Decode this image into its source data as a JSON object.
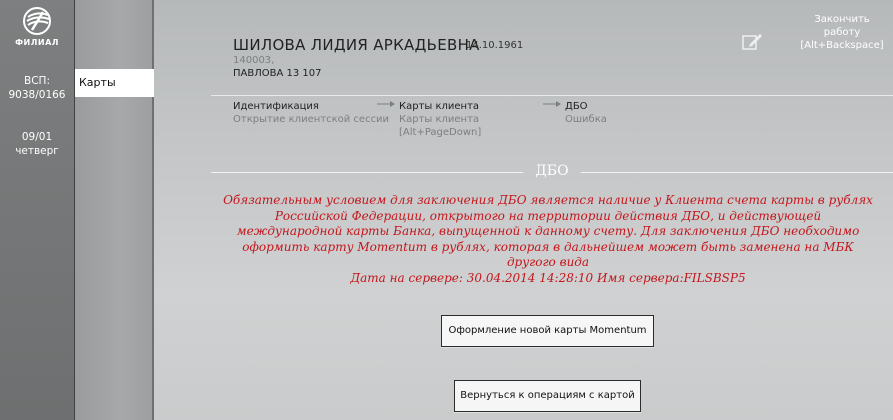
{
  "sidebar": {
    "logo_text": "ФИЛИАЛ",
    "vsp_label": "ВСП:",
    "vsp_value": "9038/0166",
    "date_value": "09/01",
    "weekday": "четверг"
  },
  "nav": {
    "items": [
      {
        "label": "Карты",
        "active": true
      }
    ]
  },
  "client": {
    "name": "ШИЛОВА ЛИДИЯ АРКАДЬЕВНА",
    "dob": "14.10.1961",
    "zip": "140003,",
    "address": "ПАВЛОВА 13 107"
  },
  "header": {
    "finish_line1": "Закончить",
    "finish_line2": "работу",
    "finish_shortcut": "[Alt+Backspace]"
  },
  "steps": [
    {
      "title": "Идентификация",
      "sub": "Открытие клиентской сессии"
    },
    {
      "title": "Карты клиента",
      "sub": "Карты клиента",
      "sub2": "[Alt+PageDown]"
    },
    {
      "title": "ДБО",
      "sub": "Ошибка"
    }
  ],
  "section": {
    "title": "ДБО"
  },
  "message": {
    "lines": [
      "Обязательным условием для заключения ДБО является наличие у Клиента счета карты в рублях",
      "Российской Федерации, открытого на территории действия ДБО, и действующей",
      "международной карты Банка, выпущенной к данному счету. Для заключения ДБО необходимо",
      "оформить карту Momentum в рублях, которая в дальнейшем может быть заменена на МБК",
      "другого вида",
      "Дата на сервере: 30.04.2014 14:28:10 Имя сервера:FILSBSP5"
    ]
  },
  "buttons": {
    "new_card": "Оформление новой карты Momentum",
    "back": "Вернуться к операциям с картой"
  },
  "colors": {
    "accent_red": "#c4161c",
    "rail": "#6f7172"
  },
  "icons": {
    "logo": "bank-logo-icon",
    "edit": "edit-pencil-icon",
    "arrow": "arrow-right-icon"
  }
}
